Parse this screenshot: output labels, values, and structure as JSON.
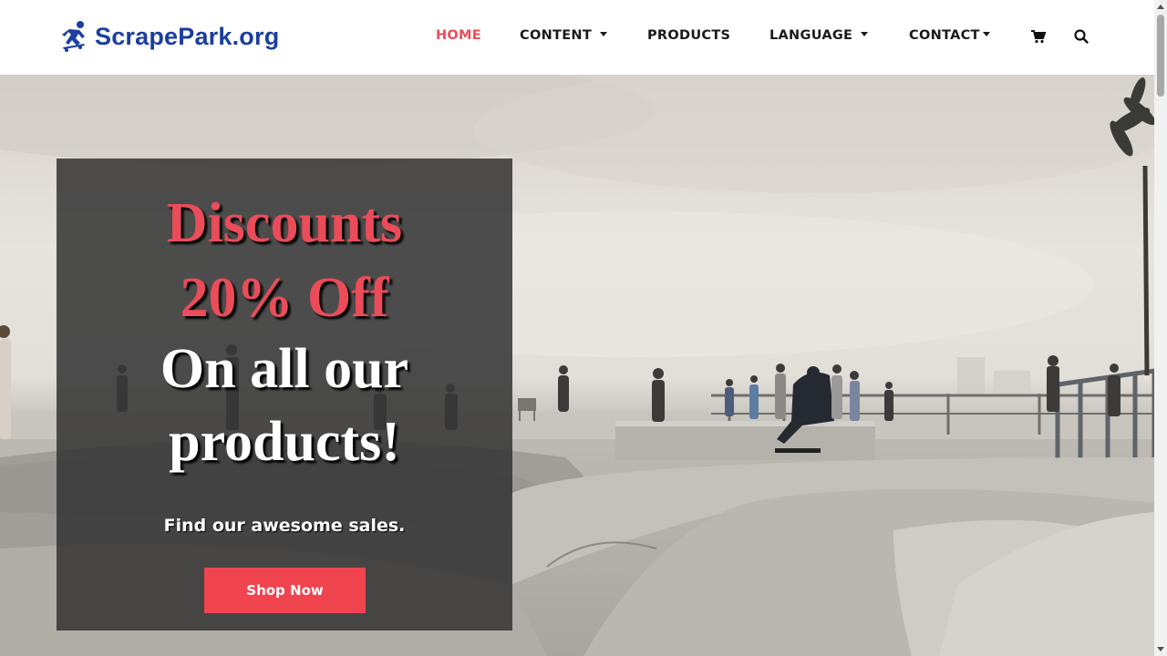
{
  "brand": {
    "name": "ScrapePark.org",
    "color": "#1c3ea0"
  },
  "nav": {
    "items": [
      {
        "label": "HOME",
        "active": true,
        "dropdown": false
      },
      {
        "label": "CONTENT",
        "active": false,
        "dropdown": true
      },
      {
        "label": "PRODUCTS",
        "active": false,
        "dropdown": false
      },
      {
        "label": "LANGUAGE",
        "active": false,
        "dropdown": true
      },
      {
        "label": "CONTACT",
        "active": false,
        "dropdown": true
      }
    ],
    "icons": [
      "cart-icon",
      "search-icon"
    ],
    "active_color": "#ea4c59"
  },
  "hero": {
    "headline_red_1": "Discounts",
    "headline_red_2": "20% Off",
    "headline_white_1": "On all our",
    "headline_white_2": "products!",
    "subtitle": "Find our awesome sales.",
    "button_label": "Shop Now",
    "accent_color": "#f0444f"
  }
}
